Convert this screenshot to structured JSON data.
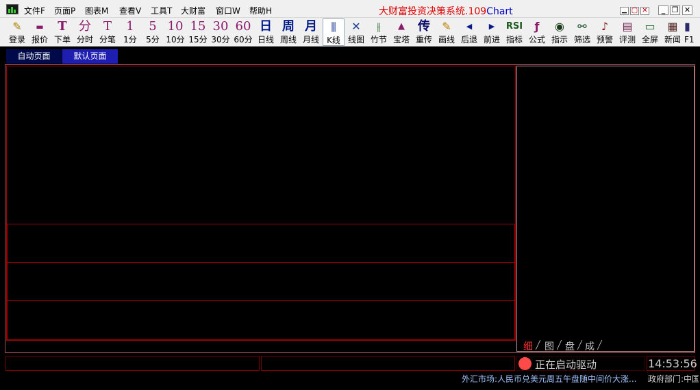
{
  "menu": {
    "items": [
      "文件F",
      "页面P",
      "图表M",
      "查看V",
      "工具T",
      "大财富",
      "窗口W",
      "帮助H"
    ],
    "title_main": "大财富投资决策系统.109",
    "title_suffix": "Chart"
  },
  "window_controls": {
    "inner_min": "▁",
    "inner_restore": "▢",
    "inner_close": "✕",
    "outer_min": "_",
    "outer_restore": "❐",
    "outer_close": "✕"
  },
  "toolbar": [
    {
      "name": "login",
      "label": "登录",
      "glyph": "✎",
      "icon": "pencil-icon"
    },
    {
      "name": "quote",
      "label": "报价",
      "glyph": "▬",
      "icon": "quote-icon"
    },
    {
      "name": "order",
      "label": "下单",
      "glyph": "T",
      "icon": "order-icon"
    },
    {
      "name": "intraday",
      "label": "分时",
      "glyph": "分",
      "icon": "intraday-icon"
    },
    {
      "name": "tick",
      "label": "分笔",
      "glyph": "T",
      "icon": "tick-icon"
    },
    {
      "name": "1min",
      "label": "1分",
      "glyph": "1",
      "icon": "one-icon"
    },
    {
      "name": "5min",
      "label": "5分",
      "glyph": "5",
      "icon": "five-icon"
    },
    {
      "name": "10min",
      "label": "10分",
      "glyph": "10",
      "icon": "ten-icon"
    },
    {
      "name": "15min",
      "label": "15分",
      "glyph": "15",
      "icon": "fifteen-icon"
    },
    {
      "name": "30min",
      "label": "30分",
      "glyph": "30",
      "icon": "thirty-icon"
    },
    {
      "name": "60min",
      "label": "60分",
      "glyph": "60",
      "icon": "sixty-icon"
    },
    {
      "name": "daily",
      "label": "日线",
      "glyph": "日",
      "icon": "day-icon"
    },
    {
      "name": "weekly",
      "label": "周线",
      "glyph": "周",
      "icon": "week-icon"
    },
    {
      "name": "monthly",
      "label": "月线",
      "glyph": "月",
      "icon": "month-icon"
    },
    {
      "name": "kline",
      "label": "K线",
      "glyph": "⫼",
      "icon": "candlestick-icon"
    },
    {
      "name": "linechart",
      "label": "线图",
      "glyph": "✕",
      "icon": "line-chart-icon"
    },
    {
      "name": "bamboo",
      "label": "竹节",
      "glyph": "⫲",
      "icon": "bamboo-icon"
    },
    {
      "name": "tower",
      "label": "宝塔",
      "glyph": "▲",
      "icon": "tower-icon"
    },
    {
      "name": "retransmit",
      "label": "重传",
      "glyph": "传",
      "icon": "retransmit-icon"
    },
    {
      "name": "draw",
      "label": "画线",
      "glyph": "✎",
      "icon": "draw-icon"
    },
    {
      "name": "back",
      "label": "后退",
      "glyph": "◀",
      "icon": "back-icon"
    },
    {
      "name": "forward",
      "label": "前进",
      "glyph": "▶",
      "icon": "forward-icon"
    },
    {
      "name": "indicator",
      "label": "指标",
      "glyph": "RSI",
      "icon": "rsi-icon"
    },
    {
      "name": "formula",
      "label": "公式",
      "glyph": "ƒ",
      "icon": "formula-icon"
    },
    {
      "name": "signal",
      "label": "指示",
      "glyph": "◉",
      "icon": "signal-icon"
    },
    {
      "name": "filter",
      "label": "筛选",
      "glyph": "⚯",
      "icon": "binoculars-icon"
    },
    {
      "name": "alert",
      "label": "预警",
      "glyph": "♪",
      "icon": "alert-icon"
    },
    {
      "name": "review",
      "label": "评测",
      "glyph": "▤",
      "icon": "review-icon"
    },
    {
      "name": "fullscreen",
      "label": "全屏",
      "glyph": "▭",
      "icon": "monitor-icon"
    },
    {
      "name": "news",
      "label": "新闻",
      "glyph": "▦",
      "icon": "news-icon"
    },
    {
      "name": "f1",
      "label": "F1",
      "glyph": "▮",
      "icon": "f1-icon"
    }
  ],
  "tabs": [
    {
      "label": "自动页面",
      "active": false
    },
    {
      "label": "默认页面",
      "active": true
    }
  ],
  "side_tabs": [
    {
      "label": "细",
      "active": true
    },
    {
      "label": "图",
      "active": false
    },
    {
      "label": "盘",
      "active": false
    },
    {
      "label": "成",
      "active": false
    }
  ],
  "status": {
    "driver_text": "正在启动驱动",
    "clock": "14:53:56",
    "ticker_1": "外汇市场:人民币兑美元周五午盘随中间价大涨...",
    "ticker_2": "政府部门:中国"
  },
  "colors": {
    "accent_red": "#e00000",
    "panel_border": "#a00000",
    "tab_active": "#1e1eb0",
    "status_light": "#ff4a4a"
  }
}
